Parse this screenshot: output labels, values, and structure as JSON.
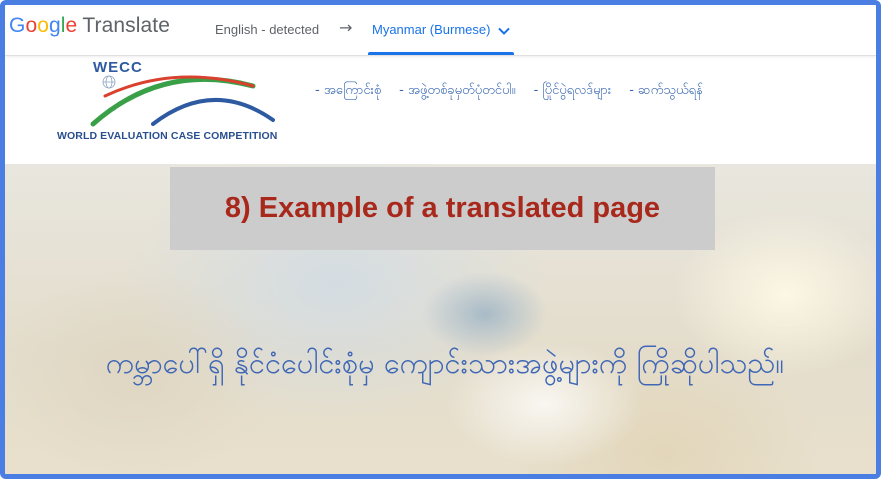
{
  "translate_bar": {
    "logo_letters": [
      "G",
      "o",
      "o",
      "g",
      "l",
      "e"
    ],
    "logo_word": "Translate",
    "source_language": "English - detected",
    "arrow": "→",
    "target_language": "Myanmar (Burmese)"
  },
  "site": {
    "logo_title": "WECC",
    "logo_tagline": "WORLD EVALUATION CASE COMPETITION",
    "nav": [
      "- အကြောင်းစုံ",
      "- အဖွဲ့တစ်ခုမှတ်ပုံတင်ပါ။",
      "- ပြိုင်ပွဲရလဒ်များ",
      "- ဆက်သွယ်ရန်"
    ],
    "hero_text": "ကမ္ဘာပေါ်ရှိ နိုင်ငံပေါင်းစုံမှ ကျောင်းသားအဖွဲ့များကို ကြိုဆိုပါသည်။"
  },
  "caption": "8) Example of a translated page",
  "colors": {
    "frame_border": "#4a7ee3",
    "translate_accent": "#1a73e8",
    "caption_text": "#a8281b",
    "caption_bg": "#cccccc",
    "logo_green": "#3aa048",
    "logo_red": "#d9402e",
    "logo_blue": "#2d5aa0"
  }
}
